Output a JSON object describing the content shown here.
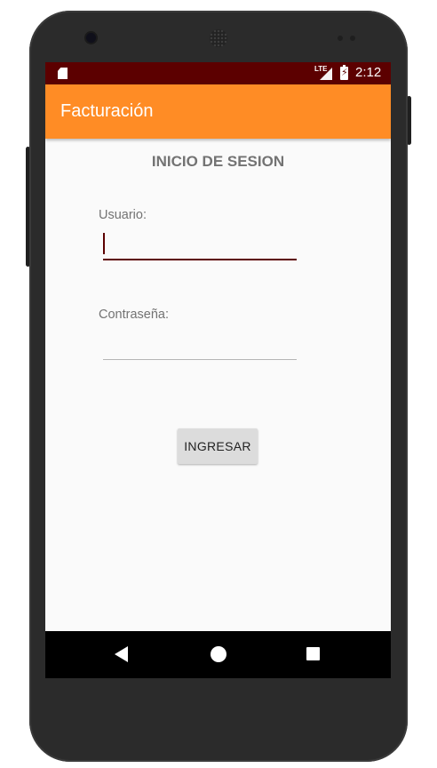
{
  "status_bar": {
    "time": "2:12",
    "network": "LTE",
    "icons": [
      "sd-card-icon",
      "signal-icon",
      "battery-charging-icon"
    ]
  },
  "app_bar": {
    "title": "Facturación",
    "color": "#ff8c25"
  },
  "login": {
    "heading": "INICIO DE SESION",
    "username_label": "Usuario:",
    "username_value": "",
    "password_label": "Contraseña:",
    "password_value": "",
    "submit_label": "INGRESAR"
  },
  "nav_bar": {
    "icons": [
      "back-icon",
      "home-icon",
      "recents-icon"
    ]
  },
  "colors": {
    "status_bar": "#5c0000",
    "accent": "#5c0000",
    "background": "#fafafa"
  }
}
